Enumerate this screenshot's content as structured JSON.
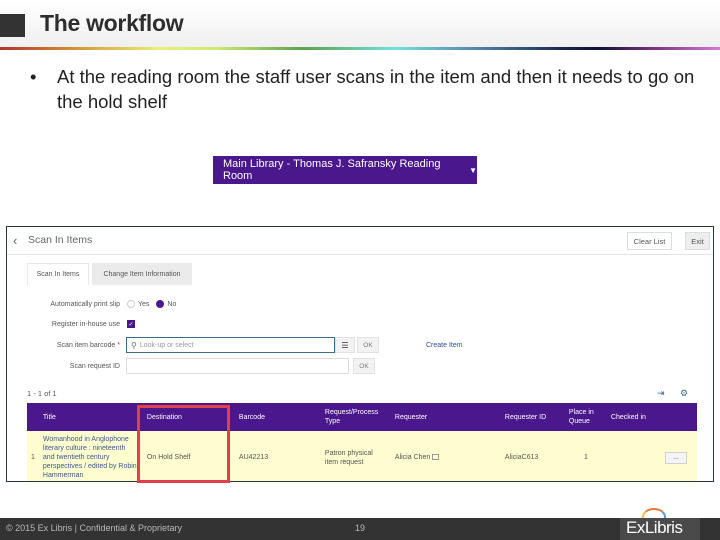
{
  "slide": {
    "title": "The workflow",
    "bullet": "At the reading room the staff user scans in the item and then it needs to go on the hold shelf",
    "bullet_symbol": "•"
  },
  "location": {
    "label": "Main Library - Thomas J. Safransky Reading Room",
    "caret": "▼"
  },
  "app": {
    "back_icon": "‹",
    "page_title": "Scan In Items",
    "clear_list": "Clear List",
    "exit": "Exit",
    "tabs": [
      {
        "label": "Scan In Items",
        "active": true
      },
      {
        "label": "Change Item Information",
        "active": false
      }
    ],
    "form": {
      "print_slip_label": "Automatically print slip",
      "print_slip_options": [
        "Yes",
        "No"
      ],
      "print_slip_value": "No",
      "inhouse_label": "Register in-house use",
      "inhouse_checked": "✓",
      "barcode_label": "Scan item barcode",
      "required_mark": "*",
      "barcode_placeholder": "Look-up or select",
      "search_icon": "⚲",
      "list_icon": "☰",
      "ok": "OK",
      "request_label": "Scan request ID",
      "request_value": "",
      "create_item": "Create Item"
    },
    "results": {
      "count": "1 - 1 of 1",
      "export_icon": "⇥",
      "settings_icon": "⚙",
      "columns": [
        "Title",
        "Destination",
        "Barcode",
        "Request/Process Type",
        "Requester",
        "Requester ID",
        "Place in Queue",
        "Checked in"
      ],
      "rows": [
        {
          "num": "1",
          "title": "Womanhood in Anglophone literary culture : nineteenth and twentieth century perspectives / edited by Robin Hammerman",
          "destination": "On Hold Shelf",
          "barcode": "AU42213",
          "request_type": "Patron physical item request",
          "requester": "Alicia Chen",
          "requester_id": "AliciaC613",
          "place_in_queue": "1",
          "checked_in": "",
          "actions": "..."
        }
      ]
    }
  },
  "footer": {
    "copyright": "© 2015 Ex Libris | Confidential & Proprietary",
    "page_number": "19",
    "logo": "ExLibris"
  }
}
